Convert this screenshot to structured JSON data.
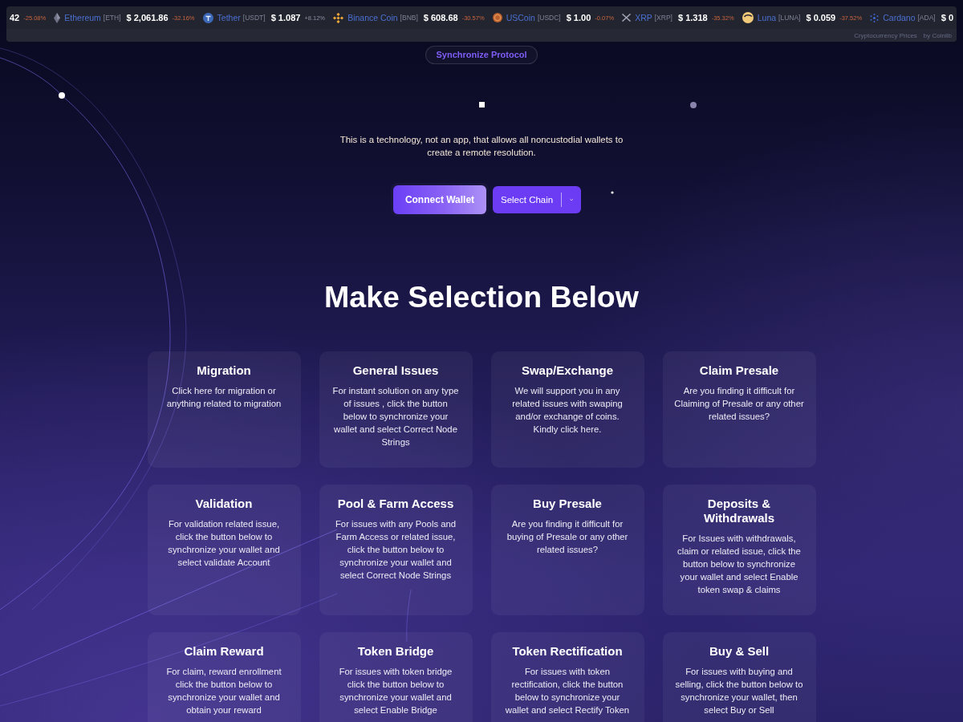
{
  "ticker": {
    "items": [
      {
        "kind": "cut",
        "price": "42",
        "change": "-25.08%",
        "negative": true
      },
      {
        "kind": "diamond",
        "name": "Ethereum",
        "symbol": "[ETH]",
        "price": "$ 2,061.86",
        "change": "-32.16%",
        "negative": true
      },
      {
        "kind": "t-coin",
        "name": "Tether",
        "symbol": "[USDT]",
        "price": "$ 1.087",
        "change": "+8.12%",
        "negative": false
      },
      {
        "kind": "rhombus",
        "name": "Binance Coin",
        "symbol": "[BNB]",
        "price": "$ 608.68",
        "change": "-30.57%",
        "negative": true
      },
      {
        "kind": "ring-coin",
        "name": "USCoin",
        "symbol": "[USDC]",
        "price": "$ 1.00",
        "change": "-0.07%",
        "negative": true
      },
      {
        "kind": "cross",
        "name": "XRP",
        "symbol": "[XRP]",
        "price": "$ 1.318",
        "change": "-35.32%",
        "negative": true
      },
      {
        "kind": "crescent",
        "name": "Luna",
        "symbol": "[LUNA]",
        "price": "$ 0.059",
        "change": "-37.52%",
        "negative": true
      },
      {
        "kind": "sun",
        "name": "Cardano",
        "symbol": "[ADA]",
        "price": "$ 0"
      }
    ],
    "footer": [
      "Cryptocurrency Prices",
      "by Coinlib"
    ]
  },
  "badge": "Synchronize Protocol",
  "intro": "This is a technology, not an app, that allows all noncustodial wallets to create a remote resolution.",
  "actions": {
    "connect": "Connect Wallet",
    "select": "Select Chain"
  },
  "heading": "Make Selection Below",
  "cards": [
    {
      "title": "Migration",
      "description": "Click here for migration or anything related to migration"
    },
    {
      "title": "General Issues",
      "description": "For instant solution on any type of issues , click the button below to synchronize your wallet and select Correct Node Strings"
    },
    {
      "title": "Swap/Exchange",
      "description": "We will support you in any related issues with swaping and/or exchange of coins. Kindly click here."
    },
    {
      "title": "Claim Presale",
      "description": "Are you finding it difficult for Claiming of Presale or any other related issues?"
    },
    {
      "title": "Validation",
      "description": "For validation related issue, click the button below to synchronize your wallet and select validate Account"
    },
    {
      "title": "Pool & Farm Access",
      "description": "For issues with any Pools and Farm Access or related issue, click the button below to synchronize your wallet and select Correct Node Strings"
    },
    {
      "title": "Buy Presale",
      "description": "Are you finding it difficult for buying of Presale or any other related issues?"
    },
    {
      "title": "Deposits & Withdrawals",
      "description": "For Issues with withdrawals, claim or related issue, click the button below to synchronize your wallet and select Enable token swap & claims"
    },
    {
      "title": "Claim Reward",
      "description": "For claim, reward enrollment click the button below to synchronize your wallet and obtain your reward"
    },
    {
      "title": "Token Bridge",
      "description": "For issues with token bridge click the button below to synchronize your wallet and select Enable Bridge"
    },
    {
      "title": "Token Rectification",
      "description": "For issues with token rectification, click the button below to synchronize your wallet and select Rectify Token"
    },
    {
      "title": "Buy & Sell",
      "description": "For issues with buying and selling, click the button below to synchronize your wallet, then select Buy or Sell"
    }
  ]
}
